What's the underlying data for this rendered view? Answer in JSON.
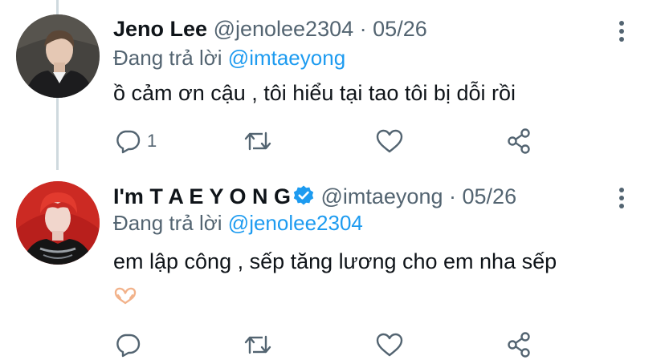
{
  "tweets": [
    {
      "display_name": "Jeno Lee",
      "handle": "@jenolee2304",
      "separator": "·",
      "date": "05/26",
      "replying_label": "Đang trả lời",
      "replying_to": "@imtaeyong",
      "text": "ồ cảm ơn cậu , tôi hiểu tại tao tôi bị dỗi rồi",
      "reply_count": "1",
      "verified": false
    },
    {
      "display_name": "I'm T A E Y O N G",
      "handle": "@imtaeyong",
      "separator": "·",
      "date": "05/26",
      "replying_label": "Đang trả lời",
      "replying_to": "@jenolee2304",
      "text": "em lập công , sếp tăng lương cho em nha sếp",
      "emoji": "🫶",
      "reply_count": "",
      "verified": true
    }
  ],
  "icons": {
    "reply": "reply-icon",
    "retweet": "retweet-icon",
    "like": "like-icon",
    "share": "share-icon",
    "more": "more-icon",
    "verified": "verified-badge-icon"
  },
  "colors": {
    "link": "#1d9bf0",
    "secondary_text": "#536471",
    "primary_text": "#0f1419",
    "thread_line": "#cfd9de"
  }
}
